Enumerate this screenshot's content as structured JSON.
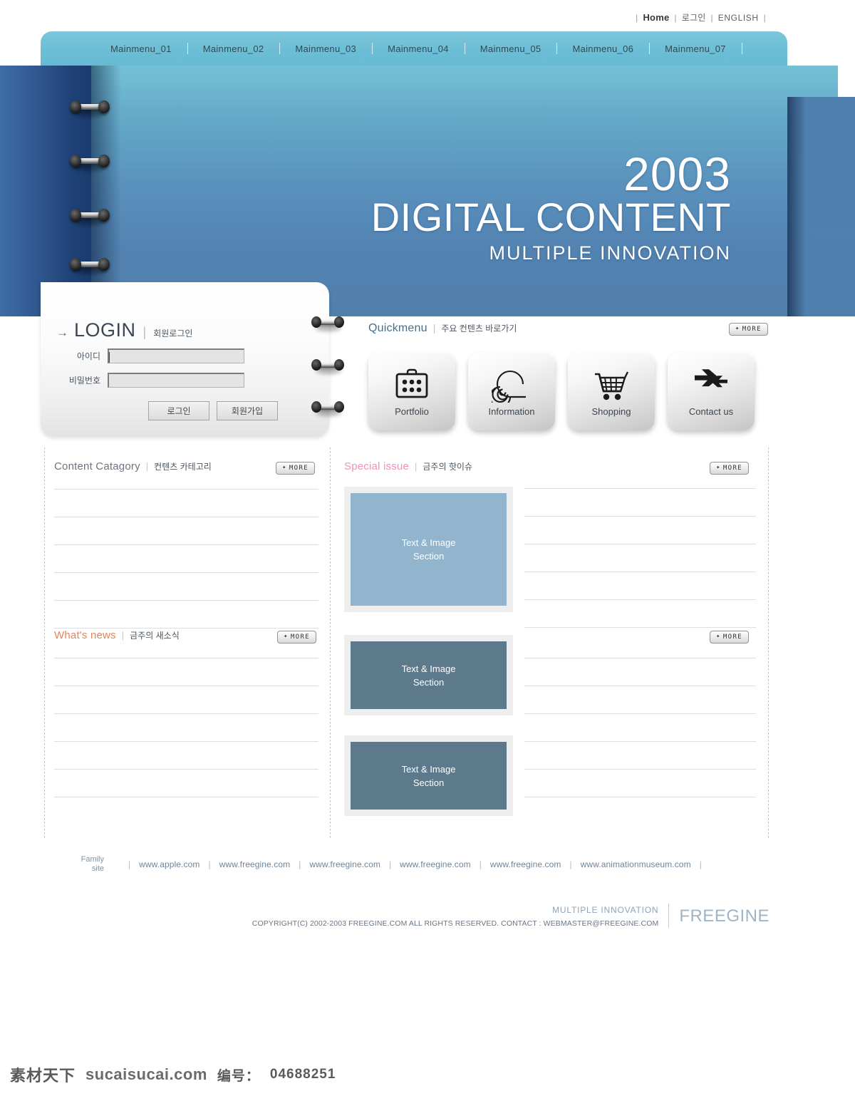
{
  "utility_nav": {
    "pipe": "|",
    "items": [
      {
        "label": "Home",
        "name": "home"
      },
      {
        "label": "로그인",
        "name": "login"
      },
      {
        "label": "ENGLISH",
        "name": "english"
      }
    ]
  },
  "mainmenu": {
    "items": [
      "Mainmenu_01",
      "Mainmenu_02",
      "Mainmenu_03",
      "Mainmenu_04",
      "Mainmenu_05",
      "Mainmenu_06",
      "Mainmenu_07"
    ]
  },
  "hero": {
    "year": "2003",
    "title": "DIGITAL CONTENT",
    "subtitle": "MULTIPLE INNOVATION"
  },
  "login": {
    "arrow": "→",
    "title": "LOGIN",
    "divider": "|",
    "subtitle": "회원로그인",
    "id_label": "아이디",
    "id_value": "",
    "pw_label": "비밀번호",
    "pw_value": "",
    "login_button": "로그인",
    "join_button": "회원가입"
  },
  "quickmenu": {
    "title": "Quickmenu",
    "divider": "|",
    "subtitle": "주요 컨텐츠 바로가기",
    "more": "MORE",
    "more_plus": "✦",
    "buttons": [
      {
        "label": "Portfolio",
        "icon": "briefcase-icon"
      },
      {
        "label": "Information",
        "icon": "spiral-icon"
      },
      {
        "label": "Shopping",
        "icon": "shopping-cart-icon"
      },
      {
        "label": "Contact us",
        "icon": "arrows-icon"
      }
    ]
  },
  "sections": {
    "content_category": {
      "title": "Content Catagory",
      "divider": "|",
      "subtitle": "컨텐츠 카테고리",
      "title_color": "#6b7480",
      "more": "MORE"
    },
    "whats_news": {
      "title": "What's news",
      "divider": "|",
      "subtitle": "금주의 새소식",
      "title_color": "#e3855c",
      "more": "MORE"
    },
    "special_issue": {
      "title": "Special issue",
      "divider": "|",
      "subtitle": "금주의 핫이슈",
      "title_color": "#f28ec0",
      "more": "MORE"
    },
    "right_more": "MORE"
  },
  "image_placeholders": [
    {
      "line1": "Text & Image",
      "line2": "Section",
      "color": "#92b4cc"
    },
    {
      "line1": "Text & Image",
      "line2": "Section",
      "color": "#5d7a8c"
    },
    {
      "line1": "Text & Image",
      "line2": "Section",
      "color": "#5d7a8c"
    }
  ],
  "family_site": {
    "label_line1": "Family",
    "label_line2": "site",
    "separator": "|",
    "links": [
      "www.apple.com",
      "www.freegine.com",
      "www.freegine.com",
      "www.freegine.com",
      "www.freegine.com",
      "www.animationmuseum.com"
    ]
  },
  "footer": {
    "slogan": "MULTIPLE INNOVATION",
    "copyright": "COPYRIGHT(C) 2002-2003 FREEGINE.COM ALL RIGHTS RESERVED. CONTACT : WEBMASTER@FREEGINE.COM",
    "brand": "FREEGINE"
  },
  "watermark": {
    "cn": "素材天下",
    "domain": "sucaisucai.com",
    "number_label": "编号：",
    "number": "04688251"
  },
  "colors": {
    "teal_menu": "#6cbed6",
    "hero_blue": "#5383b2",
    "spine_dark": "#1f4277",
    "accent_pink": "#f28ec0",
    "accent_orange": "#e3855c"
  }
}
